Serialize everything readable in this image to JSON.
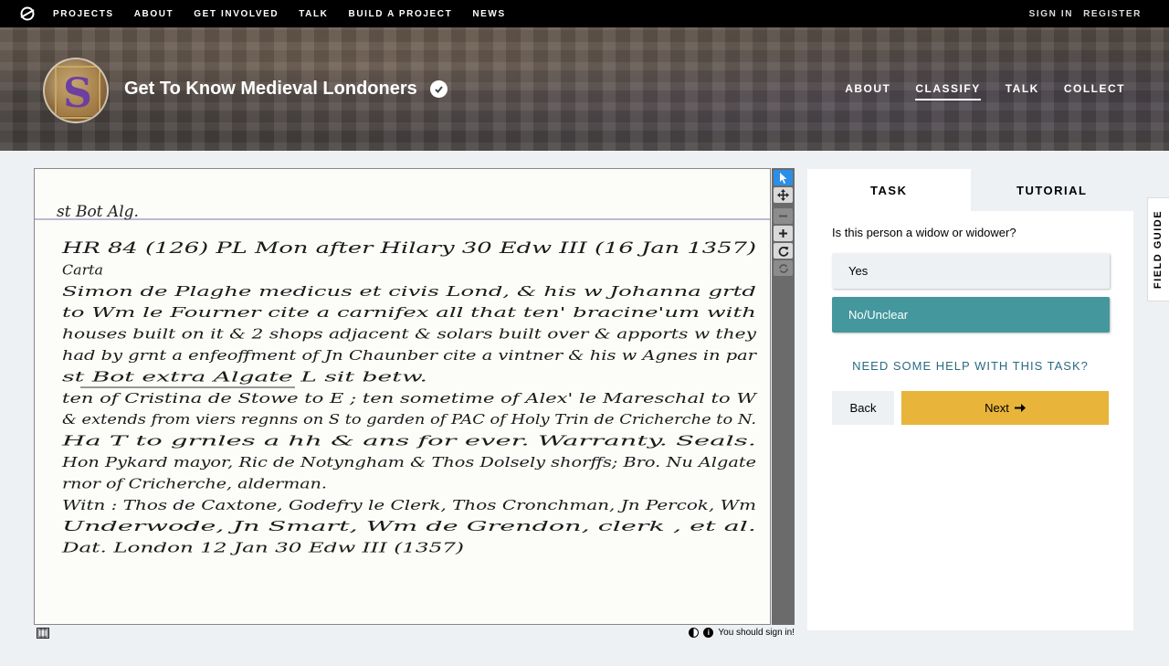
{
  "topnav": {
    "logo_icon": "zooniverse-logo-icon",
    "links": [
      "PROJECTS",
      "ABOUT",
      "GET INVOLVED",
      "TALK",
      "BUILD A PROJECT",
      "NEWS"
    ],
    "sign_in": "SIGN IN",
    "register": "REGISTER"
  },
  "project": {
    "title": "Get To Know Medieval Londoners",
    "verified_icon": "check-badge-icon",
    "nav": [
      "ABOUT",
      "CLASSIFY",
      "TALK",
      "COLLECT"
    ],
    "active_nav": "CLASSIFY"
  },
  "subject": {
    "header": "st Bot Alg.",
    "lines": [
      "HR 84 (126)        PL    Mon  after Hilary    30 Edw III   (16 Jan 1357)",
      "Carta",
      "Simon  de  Plaghe  medicus  et  civis Lond,  & his w  Johanna  grtd",
      "to  Wm  le  Fourner  cite  a  carnifex   all that  ten' bracine'um  with",
      "houses built on it  & 2 shops  adjacent  & solars  built over  & apports  w they",
      "had by  grnt  a  enfeoffment of  Jn  Chaunber  cite a vintner  & his w  Agnes  in par",
      "st  Bot  extra   Algate  L        sit  betw.",
      "      ten of  Cristina  de Stowe  to E ;  ten sometime of  Alex'  le Mareschal  to W",
      "& extends  from   viers  regnns   on  S   to  garden of  PAC of  Holy Trin de Cricherche to N.",
      "Ha  T  to  grnles   a hh  & ans    for ever.  Warranty.   Seals.",
      "Hon Pykard  mayor,  Ric  de  Notyngham  & Thos  Dolsely  shorffs;  Bro. Nu Algate",
      "rnor of  Cricherche,  alderman.",
      "Witn :  Thos  de  Caxtone,  Godefry le Clerk,  Thos  Cronchman,  Jn  Percok,  Wm",
      "Underwode,  Jn  Smart,   Wm de  Grendon,  clerk ,   et  al.",
      "Dat.   London        12 Jan   30  Edw III   (1357)"
    ],
    "toolbar_icons": [
      "pointer-icon",
      "move-icon",
      "zoom-out-icon",
      "zoom-in-icon",
      "rotate-icon",
      "reset-icon"
    ],
    "film_icon": "film-icon",
    "invert_icon": "contrast-icon",
    "info_icon": "info-icon",
    "signin_note": "You should sign in!"
  },
  "task": {
    "tabs": [
      "TASK",
      "TUTORIAL"
    ],
    "question": "Is this person a widow or widower?",
    "answers": [
      "Yes",
      "No/Unclear"
    ],
    "selected_answer": "No/Unclear",
    "help_link": "NEED SOME HELP WITH THIS TASK?",
    "back_label": "Back",
    "next_label": "Next",
    "next_icon": "arrow-right-icon"
  },
  "field_guide": "FIELD GUIDE",
  "colors": {
    "accent_teal": "#43979d",
    "next_yellow": "#e8b43a",
    "help_link": "#2a6b80",
    "selected_tool": "#2b8fe8"
  }
}
